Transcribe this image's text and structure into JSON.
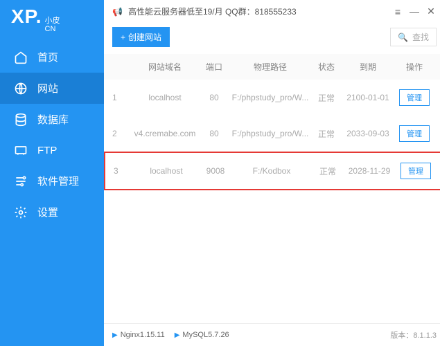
{
  "logo": {
    "main": "XP.",
    "sub1": "小皮",
    "sub2": "CN"
  },
  "sidebar": {
    "items": [
      {
        "label": "首页"
      },
      {
        "label": "网站"
      },
      {
        "label": "数据库"
      },
      {
        "label": "FTP"
      },
      {
        "label": "软件管理"
      },
      {
        "label": "设置"
      }
    ]
  },
  "titlebar": {
    "promo": "高性能云服务器低至19/月  QQ群：818555233"
  },
  "toolbar": {
    "create_label": "创建网站",
    "search_placeholder": "查找"
  },
  "table": {
    "headers": {
      "domain": "网站域名",
      "port": "端口",
      "path": "物理路径",
      "status": "状态",
      "expiry": "到期",
      "actions": "操作"
    },
    "rows": [
      {
        "idx": "1",
        "domain": "localhost",
        "port": "80",
        "path": "F:/phpstudy_pro/W...",
        "status": "正常",
        "expiry": "2100-01-01",
        "action": "管理"
      },
      {
        "idx": "2",
        "domain": "v4.cremabe.com",
        "port": "80",
        "path": "F:/phpstudy_pro/W...",
        "status": "正常",
        "expiry": "2033-09-03",
        "action": "管理"
      },
      {
        "idx": "3",
        "domain": "localhost",
        "port": "9008",
        "path": "F:/Kodbox",
        "status": "正常",
        "expiry": "2028-11-29",
        "action": "管理"
      }
    ]
  },
  "statusbar": {
    "nginx": "Nginx1.15.11",
    "mysql": "MySQL5.7.26",
    "version_label": "版本：",
    "version": "8.1.1.3"
  }
}
